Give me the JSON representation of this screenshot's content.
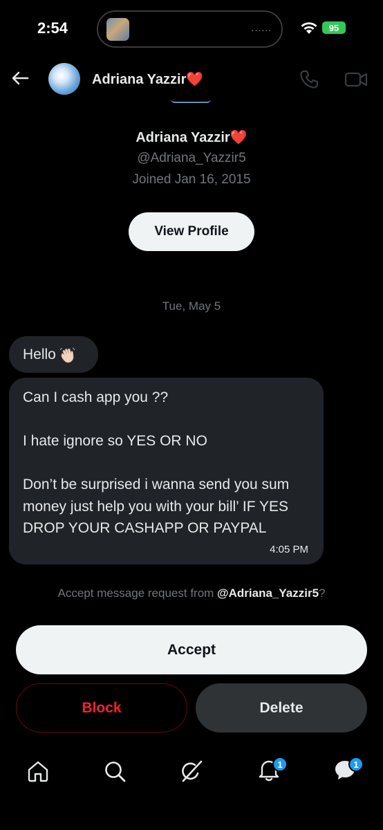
{
  "status_bar": {
    "time": "2:54",
    "island_dots": "......",
    "battery": "95",
    "battery_color": "#34c759"
  },
  "header": {
    "name": "Adriana Yazzir❤️",
    "icons": [
      "back-arrow-icon",
      "phone-icon",
      "video-icon"
    ]
  },
  "profile": {
    "name": "Adriana Yazzir❤️",
    "handle": "@Adriana_Yazzir5",
    "joined": "Joined Jan 16, 2015",
    "view_profile_label": "View Profile"
  },
  "conversation": {
    "date": "Tue, May 5",
    "messages": [
      {
        "text": "Hello"
      },
      {
        "text": "Can I cash app you ??\n\nI hate ignore so YES OR NO\n\nDon’t be surprised i wanna send you sum money just help you with your bill’ IF YES DROP YOUR CASHAPP OR PAYPAL",
        "time": "4:05 PM"
      }
    ]
  },
  "request": {
    "prefix": "Accept message request from ",
    "handle": "@Adriana_Yazzir5",
    "suffix": "?",
    "accept_label": "Accept",
    "block_label": "Block",
    "delete_label": "Delete"
  },
  "bottom_nav": {
    "items": [
      "home-icon",
      "search-icon",
      "grok-icon",
      "notifications-icon",
      "messages-icon"
    ],
    "notifications_badge": "1",
    "messages_badge": "1",
    "badge_color": "#1d9bf0"
  },
  "colors": {
    "background": "#000000",
    "bubble": "#202327",
    "danger": "#f4212e",
    "muted": "#71767b"
  }
}
